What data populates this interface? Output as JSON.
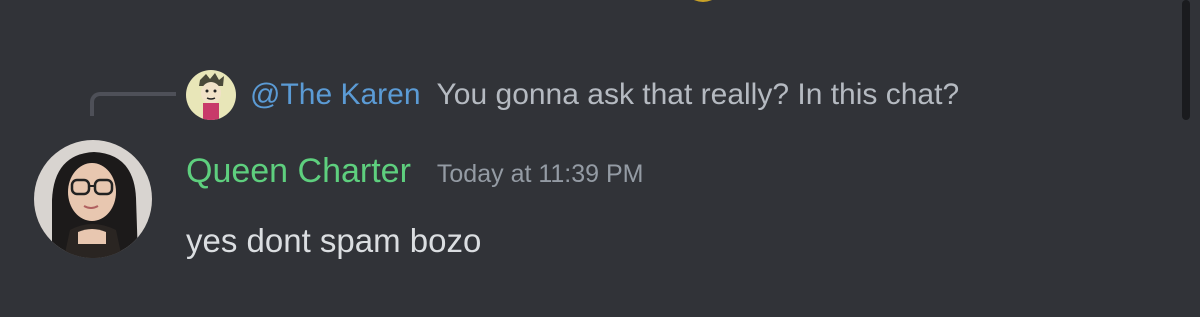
{
  "reply": {
    "author": "@The Karen",
    "text": "You gonna ask that really? In this chat?"
  },
  "message": {
    "username": "Queen Charter",
    "timestamp": "Today at 11:39 PM",
    "content": "yes dont spam bozo"
  },
  "colors": {
    "background": "#313338",
    "reply_author": "#5b9bd5",
    "username": "#5ecf7e",
    "timestamp": "#949ba4",
    "message_text": "#dbdee1"
  }
}
